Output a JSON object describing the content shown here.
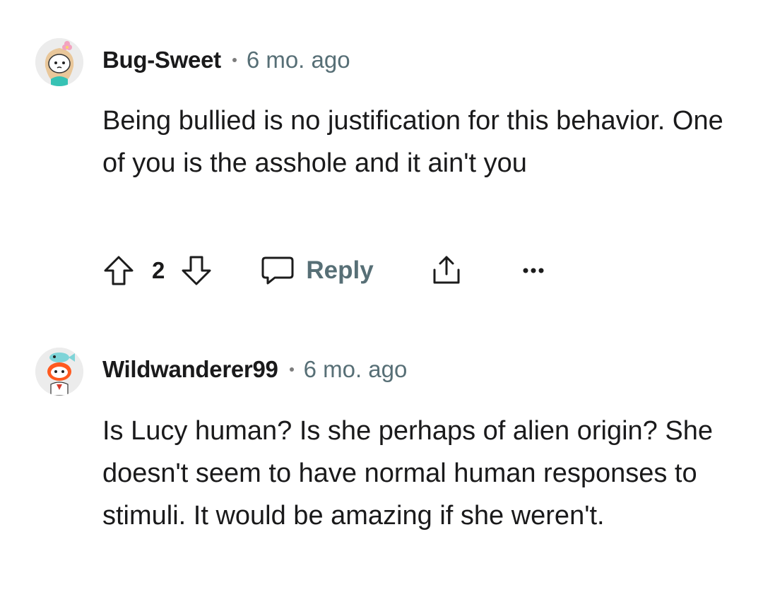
{
  "comments": [
    {
      "username": "Bug-Sweet",
      "time": "6 mo. ago",
      "body": "Being bullied is no justification for this behavior. One of you is the asshole and it ain't you",
      "votes": "2",
      "reply_label": "Reply",
      "avatar": "snoo-avatar-flower-hair"
    },
    {
      "username": "Wildwanderer99",
      "time": "6 mo. ago",
      "body": "Is Lucy human? Is she perhaps of alien origin? She doesn't seem to have normal human responses to stimuli. It would be amazing if she weren't.",
      "avatar": "snoo-avatar-fish-hat"
    }
  ],
  "icons": {
    "upvote": "arrow-up-outline-icon",
    "downvote": "arrow-down-outline-icon",
    "reply": "speech-bubble-icon",
    "share": "share-upload-icon",
    "more": "ellipsis-icon"
  },
  "colors": {
    "text": "#1a1a1b",
    "meta": "#576f76",
    "icon": "#1c1c1c"
  }
}
